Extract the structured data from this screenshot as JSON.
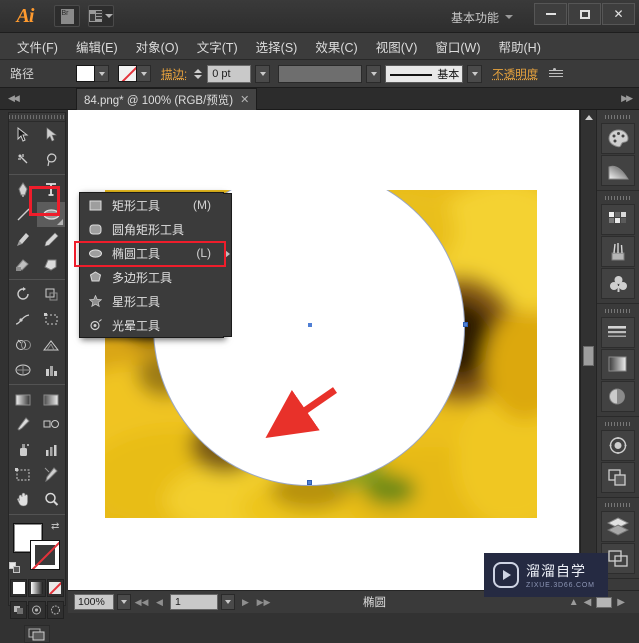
{
  "app": {
    "name": "Ai",
    "workspace": "基本功能",
    "bridge_icon": "bridge-icon",
    "arrange_icon": "arrange-documents-icon"
  },
  "window_controls": {
    "minimize": "minimize-icon",
    "maximize": "maximize-icon",
    "close": "✕"
  },
  "menubar": {
    "items": [
      {
        "label": "文件(F)"
      },
      {
        "label": "编辑(E)"
      },
      {
        "label": "对象(O)"
      },
      {
        "label": "文字(T)"
      },
      {
        "label": "选择(S)"
      },
      {
        "label": "效果(C)"
      },
      {
        "label": "视图(V)"
      },
      {
        "label": "窗口(W)"
      },
      {
        "label": "帮助(H)"
      }
    ]
  },
  "options_bar": {
    "context_label": "路径",
    "fill_color": "#ffffff",
    "stroke_color": "none",
    "stroke_label": "描边:",
    "stroke_weight": "0 pt",
    "brush_definition": "",
    "profile_label": "基本",
    "opacity_label": "不透明度",
    "panel_menu_icon": "panel-menu-icon"
  },
  "document_tab": {
    "title": "84.png* @ 100% (RGB/预览)",
    "close": "✕"
  },
  "toolbar": {
    "tools": [
      {
        "name": "selection-tool"
      },
      {
        "name": "direct-selection-tool"
      },
      {
        "name": "magic-wand-tool"
      },
      {
        "name": "lasso-tool"
      },
      {
        "name": "pen-tool"
      },
      {
        "name": "type-tool"
      },
      {
        "name": "line-segment-tool"
      },
      {
        "name": "ellipse-tool"
      },
      {
        "name": "paintbrush-tool"
      },
      {
        "name": "pencil-tool"
      },
      {
        "name": "blob-brush-tool"
      },
      {
        "name": "eraser-tool"
      },
      {
        "name": "rotate-tool"
      },
      {
        "name": "scale-tool"
      },
      {
        "name": "width-tool"
      },
      {
        "name": "free-transform-tool"
      },
      {
        "name": "shape-builder-tool"
      },
      {
        "name": "perspective-grid-tool"
      },
      {
        "name": "mesh-tool"
      },
      {
        "name": "gradient-tool"
      },
      {
        "name": "eyedropper-tool"
      },
      {
        "name": "blend-tool"
      },
      {
        "name": "symbol-sprayer-tool"
      },
      {
        "name": "column-graph-tool"
      },
      {
        "name": "artboard-tool"
      },
      {
        "name": "slice-tool"
      },
      {
        "name": "hand-tool"
      },
      {
        "name": "zoom-tool"
      }
    ],
    "fill_swatch": "#ffffff",
    "stroke_swatch": "none",
    "mode_buttons": [
      {
        "name": "color-mode-button"
      },
      {
        "name": "gradient-mode-button"
      },
      {
        "name": "none-mode-button"
      }
    ],
    "draw_modes": [
      {
        "name": "draw-normal-button"
      },
      {
        "name": "draw-behind-button"
      },
      {
        "name": "draw-inside-button"
      }
    ],
    "screen_mode": "change-screen-mode-button"
  },
  "flyout": {
    "items": [
      {
        "label": "矩形工具",
        "shortcut": "(M)",
        "icon": "rectangle-icon"
      },
      {
        "label": "圆角矩形工具",
        "shortcut": "",
        "icon": "rounded-rectangle-icon"
      },
      {
        "label": "椭圆工具",
        "shortcut": "(L)",
        "icon": "ellipse-icon"
      },
      {
        "label": "多边形工具",
        "shortcut": "",
        "icon": "polygon-icon"
      },
      {
        "label": "星形工具",
        "shortcut": "",
        "icon": "star-icon"
      },
      {
        "label": "光晕工具",
        "shortcut": "",
        "icon": "flare-icon"
      }
    ],
    "highlight_index": 2,
    "highlight_color": "#ef1d2b"
  },
  "canvas": {
    "shape": "ellipse",
    "shape_fill": "#ffffff",
    "background": "blurred-sunflower-photo",
    "anchors": 4,
    "annotation_arrow": "red-arrow"
  },
  "right_dock": {
    "groups": [
      {
        "buttons": [
          {
            "name": "color-panel-icon"
          },
          {
            "name": "gradient-panel-icon"
          }
        ]
      },
      {
        "buttons": [
          {
            "name": "swatches-panel-icon"
          },
          {
            "name": "brushes-panel-icon"
          },
          {
            "name": "symbols-panel-icon"
          }
        ]
      },
      {
        "buttons": [
          {
            "name": "stroke-panel-icon"
          },
          {
            "name": "gradient2-panel-icon"
          },
          {
            "name": "transparency-panel-icon"
          }
        ]
      },
      {
        "buttons": [
          {
            "name": "appearance-panel-icon"
          },
          {
            "name": "graphic-styles-panel-icon"
          }
        ]
      },
      {
        "buttons": [
          {
            "name": "layers-panel-icon"
          },
          {
            "name": "artboards-panel-icon"
          }
        ]
      }
    ]
  },
  "statusbar": {
    "zoom": "100%",
    "page": "1",
    "tool_status": "椭圆",
    "nav_first": "◀◀",
    "nav_prev": "◀",
    "nav_next": "▶",
    "nav_last": "▶▶"
  },
  "watermark": {
    "title": "溜溜自学",
    "subtitle": "ZIXUE.3D66.COM",
    "brand_color": "#252a42"
  }
}
